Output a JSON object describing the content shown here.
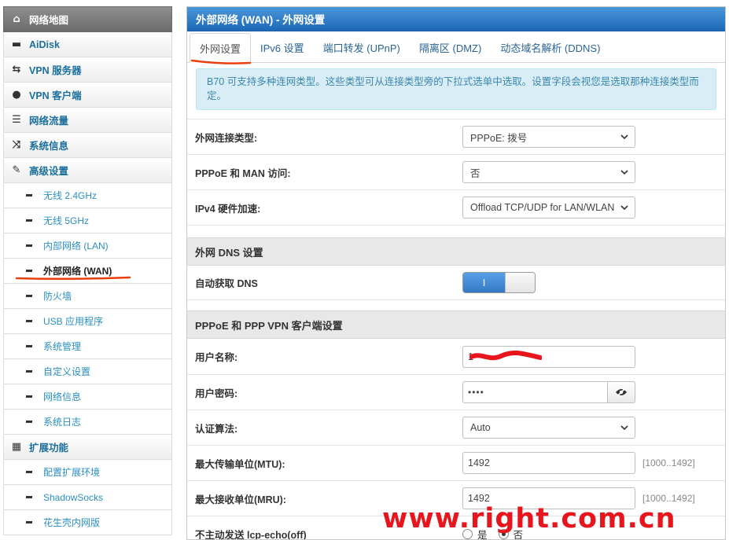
{
  "sidebar": {
    "items": [
      {
        "icon": "home-icon",
        "glyph": "⌂",
        "label": "网络地图"
      },
      {
        "icon": "disk-icon",
        "glyph": "▬",
        "label": "AiDisk"
      },
      {
        "icon": "retweet-icon",
        "glyph": "⇆",
        "label": "VPN 服务器"
      },
      {
        "icon": "globe-icon",
        "glyph": "●",
        "label": "VPN 客户端"
      },
      {
        "icon": "traffic-icon",
        "glyph": "☰",
        "label": "网络流量"
      },
      {
        "icon": "random-icon",
        "glyph": "⤨",
        "label": "系统信息"
      },
      {
        "icon": "wrench-icon",
        "glyph": "✎",
        "label": "高级设置"
      }
    ],
    "advanced": [
      "无线 2.4GHz",
      "无线 5GHz",
      "内部网络 (LAN)",
      "外部网络 (WAN)",
      "防火墙",
      "USB 应用程序",
      "系统管理",
      "自定义设置",
      "网络信息",
      "系统日志"
    ],
    "ext_label": "扩展功能",
    "ext_glyph": "▦",
    "ext": [
      "配置扩展环境",
      "ShadowSocks",
      "花生壳内网版"
    ]
  },
  "main": {
    "title": "外部网络 (WAN) - 外网设置",
    "tabs": [
      "外网设置",
      "IPv6 设置",
      "端口转发 (UPnP)",
      "隔离区 (DMZ)",
      "动态域名解析 (DDNS)"
    ],
    "info": "B70 可支持多种连网类型。这些类型可从连接类型旁的下拉式选单中选取。设置字段会视您是选取那种连接类型而定。",
    "wan_type": {
      "label": "外网连接类型:",
      "value": "PPPoE: 拨号"
    },
    "man_access": {
      "label": "PPPoE 和 MAN 访问:",
      "value": "否"
    },
    "hw_accel": {
      "label": "IPv4 硬件加速:",
      "value": "Offload TCP/UDP for LAN/WLAN"
    },
    "dns_section": "外网 DNS 设置",
    "auto_dns": {
      "label": "自动获取 DNS",
      "toggle_text": "I"
    },
    "ppp_section": "PPPoE 和 PPP VPN 客户端设置",
    "username": {
      "label": "用户名称:",
      "value": "1"
    },
    "password": {
      "label": "用户密码:",
      "value": "••••"
    },
    "auth": {
      "label": "认证算法:",
      "value": "Auto"
    },
    "mtu": {
      "label": "最大传输单位(MTU):",
      "value": "1492",
      "range": "[1000..1492]"
    },
    "mru": {
      "label": "最大接收单位(MRU):",
      "value": "1492",
      "range": "[1000..1492]"
    },
    "lcp": {
      "label": "不主动发送 lcp-echo(off)",
      "opt_yes": "是",
      "opt_no": "否"
    }
  },
  "watermark": "www.right.com.cn",
  "colors": {
    "accent": "#1d68b8",
    "annotation": "#e8400c",
    "watermark": "#e8151d"
  }
}
